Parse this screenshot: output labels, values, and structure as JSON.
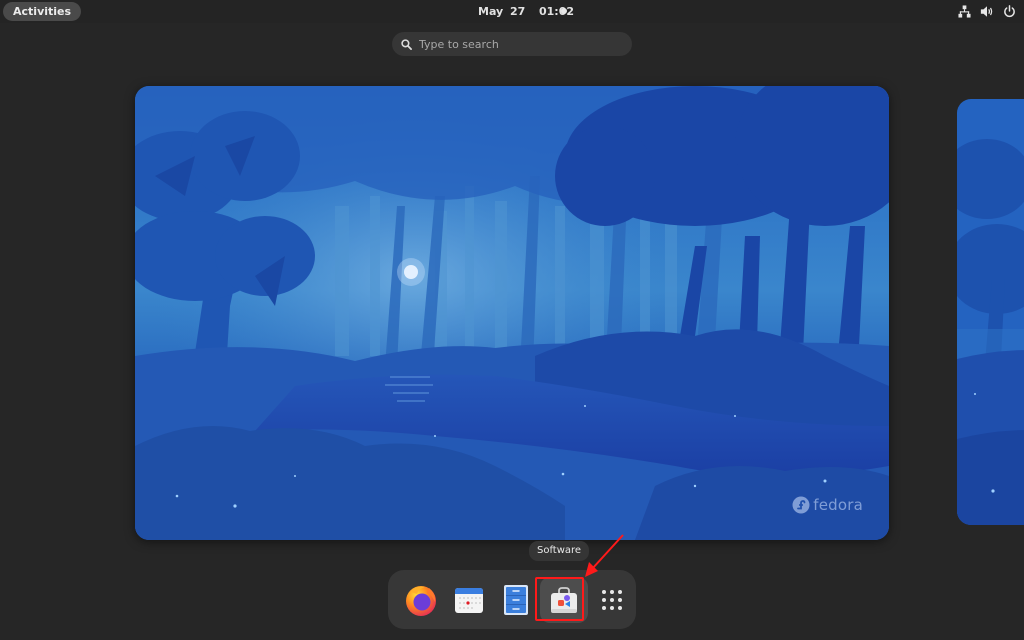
{
  "topbar": {
    "activities_label": "Activities",
    "clock": "May 27  01:02",
    "notification_indicator": "dot",
    "tray_icons": [
      "network-wired-icon",
      "volume-icon",
      "power-icon"
    ]
  },
  "search": {
    "placeholder": "Type to search",
    "value": "",
    "icon": "search-icon"
  },
  "workspaces": [
    {
      "label": "Workspace 1",
      "wallpaper": "fedora-night-forest",
      "watermark": "fedora",
      "current": true
    },
    {
      "label": "Workspace 2",
      "wallpaper": "fedora-night-forest",
      "current": false
    }
  ],
  "tooltip": {
    "text": "Software"
  },
  "dock": {
    "items": [
      {
        "name": "Firefox",
        "icon": "firefox-icon"
      },
      {
        "name": "Calendar",
        "icon": "calendar-icon"
      },
      {
        "name": "Files",
        "icon": "file-cabinet-icon"
      },
      {
        "name": "Software",
        "icon": "software-bag-icon",
        "highlighted": true
      },
      {
        "name": "Show Applications",
        "icon": "app-grid-icon"
      }
    ]
  },
  "annotation": {
    "type": "red-arrow-and-box",
    "target": "Software",
    "color": "#ff1a1a"
  },
  "colors": {
    "background": "#262626",
    "dock": "#373737",
    "search": "#363636",
    "annotation_red": "#ff1a1a",
    "wallpaper_blue": "#1f4fb0"
  }
}
